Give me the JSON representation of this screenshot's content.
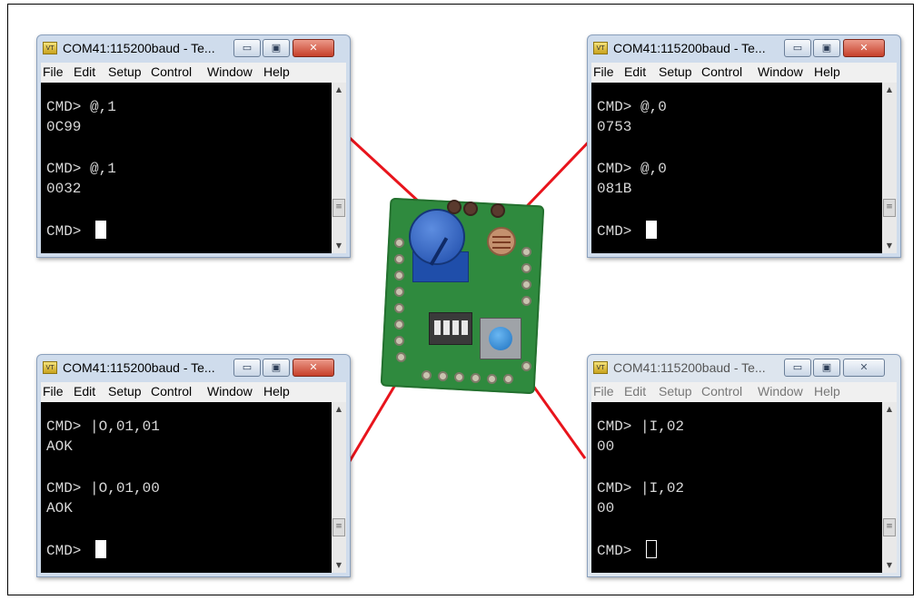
{
  "windows": [
    {
      "id": "pot",
      "title": "COM41:115200baud - Te...",
      "active": true,
      "menu": [
        "File",
        "Edit",
        "Setup",
        "Control",
        "Window",
        "Help"
      ],
      "lines": [
        "",
        "CMD> @,1",
        "0C99",
        "",
        "CMD> @,1",
        "0032",
        "",
        "CMD> "
      ],
      "cursor": "solid"
    },
    {
      "id": "ldr",
      "title": "COM41:115200baud - Te...",
      "active": true,
      "menu": [
        "File",
        "Edit",
        "Setup",
        "Control",
        "Window",
        "Help"
      ],
      "lines": [
        "",
        "CMD> @,0",
        "0753",
        "",
        "CMD> @,0",
        "081B",
        "",
        "CMD> "
      ],
      "cursor": "solid"
    },
    {
      "id": "led",
      "title": "COM41:115200baud - Te...",
      "active": true,
      "menu": [
        "File",
        "Edit",
        "Setup",
        "Control",
        "Window",
        "Help"
      ],
      "lines": [
        "",
        "CMD> |O,01,01",
        "AOK",
        "",
        "CMD> |O,01,00",
        "AOK",
        "",
        "CMD> "
      ],
      "cursor": "solid"
    },
    {
      "id": "button",
      "title": "COM41:115200baud - Te...",
      "active": false,
      "menu": [
        "File",
        "Edit",
        "Setup",
        "Control",
        "Window",
        "Help"
      ],
      "lines": [
        "",
        "CMD> |I,02",
        "00",
        "",
        "CMD> |I,02",
        "00",
        "",
        "CMD> "
      ],
      "cursor": "hollow"
    }
  ],
  "captions": {
    "minimize": "▭",
    "maximize": "▣",
    "close": "✕",
    "app_icon": "VT"
  },
  "colors": {
    "terminal_bg": "#000000",
    "terminal_text": "#d8d8d8",
    "connector": "#e8141c",
    "pcb": "#2f8a3e",
    "pot": "#1d4aa8",
    "button_cap": "#1f72c0"
  },
  "icons": [
    "app-icon",
    "minimize-icon",
    "maximize-icon",
    "close-icon",
    "scroll-up-icon",
    "scroll-down-icon",
    "scroll-grip-icon"
  ]
}
